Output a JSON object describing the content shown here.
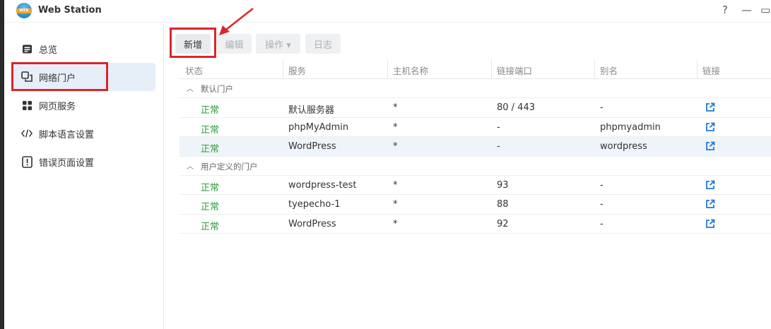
{
  "window": {
    "logo_text": "WEB",
    "title": "Web Station",
    "help_label": "?",
    "minimize_label": "—",
    "maximize_label": "▭"
  },
  "sidebar": {
    "items": [
      {
        "label": "总览",
        "icon": "overview-icon"
      },
      {
        "label": "网络门户",
        "icon": "portal-icon"
      },
      {
        "label": "网页服务",
        "icon": "services-icon"
      },
      {
        "label": "脚本语言设置",
        "icon": "code-icon"
      },
      {
        "label": "错误页面设置",
        "icon": "error-icon"
      }
    ],
    "active_index": 1
  },
  "toolbar": {
    "create_label": "新增",
    "edit_label": "编辑",
    "action_label": "操作 ▾",
    "log_label": "日志"
  },
  "table": {
    "headers": [
      "状态",
      "服务",
      "主机名称",
      "链接端口",
      "别名",
      "链接"
    ],
    "groups": [
      {
        "title": "默认门户",
        "rows": [
          {
            "status": "正常",
            "service": "默认服务器",
            "host": "*",
            "port": "80 / 443",
            "alias": "-"
          },
          {
            "status": "正常",
            "service": "phpMyAdmin",
            "host": "*",
            "port": "-",
            "alias": "phpmyadmin"
          },
          {
            "status": "正常",
            "service": "WordPress",
            "host": "*",
            "port": "-",
            "alias": "wordpress"
          }
        ]
      },
      {
        "title": "用户定义的门户",
        "rows": [
          {
            "status": "正常",
            "service": "wordpress-test",
            "host": "*",
            "port": "93",
            "alias": "-"
          },
          {
            "status": "正常",
            "service": "tyepecho-1",
            "host": "*",
            "port": "88",
            "alias": "-"
          },
          {
            "status": "正常",
            "service": "WordPress",
            "host": "*",
            "port": "92",
            "alias": "-"
          }
        ]
      }
    ]
  },
  "colors": {
    "status_ok": "#2e9c3c",
    "link_icon": "#1f7ad6",
    "highlight": "#d9262c",
    "active_nav": "#e6eef7"
  }
}
